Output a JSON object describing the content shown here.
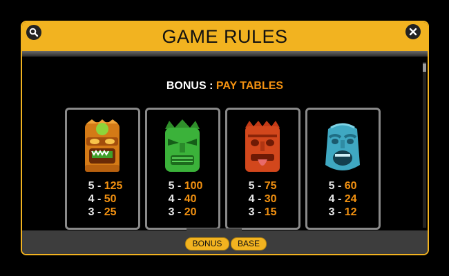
{
  "dialog": {
    "title": "GAME RULES",
    "header_icons": {
      "left": "search-icon",
      "right": "close-icon"
    }
  },
  "section": {
    "prefix": "BONUS :",
    "highlight": "PAY TABLES"
  },
  "paytables": [
    {
      "symbol": "orange-tiki-mask",
      "rows": [
        {
          "count": "5 -",
          "pay": "125"
        },
        {
          "count": "4 -",
          "pay": "50"
        },
        {
          "count": "3 -",
          "pay": "25"
        }
      ]
    },
    {
      "symbol": "green-tiki-mask",
      "rows": [
        {
          "count": "5 -",
          "pay": "100"
        },
        {
          "count": "4 -",
          "pay": "40"
        },
        {
          "count": "3 -",
          "pay": "20"
        }
      ]
    },
    {
      "symbol": "red-tiki-mask",
      "rows": [
        {
          "count": "5 -",
          "pay": "75"
        },
        {
          "count": "4 -",
          "pay": "30"
        },
        {
          "count": "3 -",
          "pay": "15"
        }
      ]
    },
    {
      "symbol": "blue-tiki-mask",
      "rows": [
        {
          "count": "5 -",
          "pay": "60"
        },
        {
          "count": "4 -",
          "pay": "24"
        },
        {
          "count": "3 -",
          "pay": "12"
        }
      ]
    }
  ],
  "tabs": {
    "bonus": "BONUS",
    "base": "BASE"
  },
  "colors": {
    "accent": "#f2b320",
    "payout": "#f29111",
    "frame": "#8a8a8a"
  }
}
